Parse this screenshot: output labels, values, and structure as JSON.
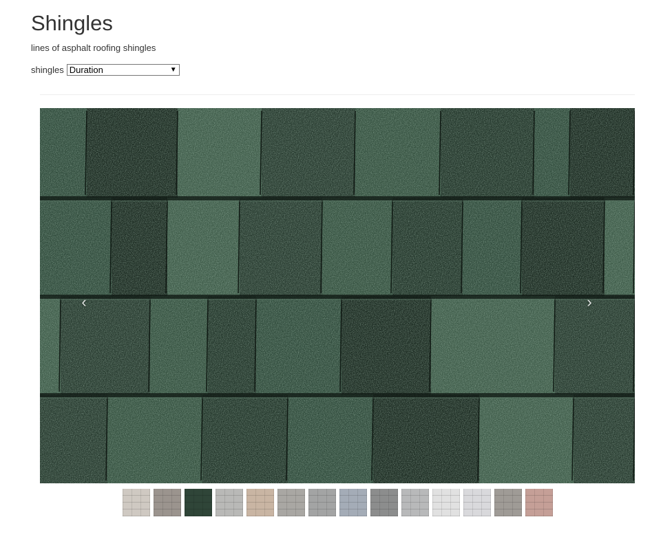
{
  "page": {
    "title": "Shingles",
    "subtitle": "lines of asphalt roofing shingles"
  },
  "picker": {
    "label": "shingles",
    "selected": "Duration"
  },
  "carousel": {
    "image_icon": "asphalt-shingle-swatch",
    "prev_icon": "chevron-left-icon",
    "next_icon": "chevron-right-icon",
    "prev_glyph": "‹",
    "next_glyph": "›"
  },
  "colors": {
    "swatch_main": "#2f4a3b",
    "swatch_dark": "#1b2a21",
    "swatch_light": "#3d5a48"
  },
  "thumbnails": [
    {
      "color": "#cfc9c2"
    },
    {
      "color": "#9b948e"
    },
    {
      "color": "#2f4538",
      "active": true
    },
    {
      "color": "#b9b9b7"
    },
    {
      "color": "#c9b5a3"
    },
    {
      "color": "#a9a7a3"
    },
    {
      "color": "#a3a4a4"
    },
    {
      "color": "#a4acb7"
    },
    {
      "color": "#8c8d8d"
    },
    {
      "color": "#b8b9ba"
    },
    {
      "color": "#e1e1e1"
    },
    {
      "color": "#d9d9dc"
    },
    {
      "color": "#9f9b96"
    },
    {
      "color": "#c59f97"
    }
  ]
}
